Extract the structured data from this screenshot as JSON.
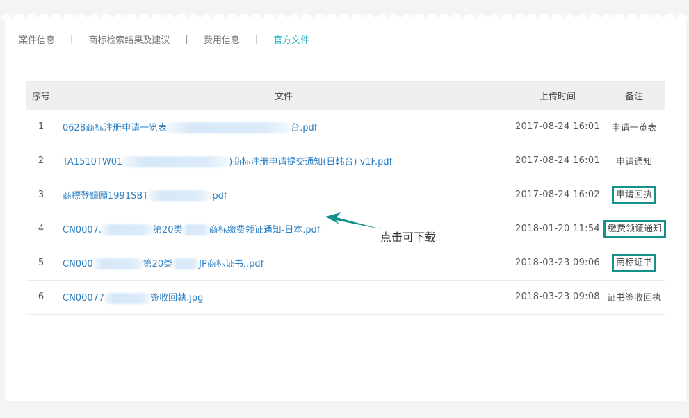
{
  "tabs": [
    {
      "label": "案件信息",
      "active": false
    },
    {
      "label": "商标检索结果及建议",
      "active": false
    },
    {
      "label": "费用信息",
      "active": false
    },
    {
      "label": "官方文件",
      "active": true
    }
  ],
  "tab_separator": "|",
  "table": {
    "headers": {
      "index": "序号",
      "file": "文件",
      "upload_time": "上传时间",
      "note": "备注"
    },
    "rows": [
      {
        "index": "1",
        "file_a": "0628商标注册申请一览表",
        "file_b": "台.pdf",
        "time": "2017-08-24 16:01",
        "note": "申请一览表",
        "highlighted": false
      },
      {
        "index": "2",
        "file_a": "TA1510TW01",
        "file_b": ")商标注册申请提交通知(日韩台) v1F.pdf",
        "time": "2017-08-24 16:01",
        "note": "申请通知",
        "highlighted": false
      },
      {
        "index": "3",
        "file_a": "商標登録願1991SBT",
        "file_b": ".pdf",
        "time": "2017-08-24 16:02",
        "note": "申请回执",
        "highlighted": true
      },
      {
        "index": "4",
        "file_a": "CN0007.",
        "file_b": "第20类",
        "file_c": "商标缴费领证通知-日本.pdf",
        "time": "2018-01-20 11:54",
        "note": "缴费领证通知",
        "highlighted": true
      },
      {
        "index": "5",
        "file_a": "CN000",
        "file_b": "第20类",
        "file_c": "JP商标证书..pdf",
        "time": "2018-03-23 09:06",
        "note": "商标证书",
        "highlighted": true
      },
      {
        "index": "6",
        "file_a": "CN00077",
        "file_b": "簽收回執.jpg",
        "time": "2018-03-23 09:08",
        "note": "证书签收回执",
        "highlighted": false
      }
    ]
  },
  "annotation": {
    "text": "点击可下载",
    "color": "#13928b"
  }
}
